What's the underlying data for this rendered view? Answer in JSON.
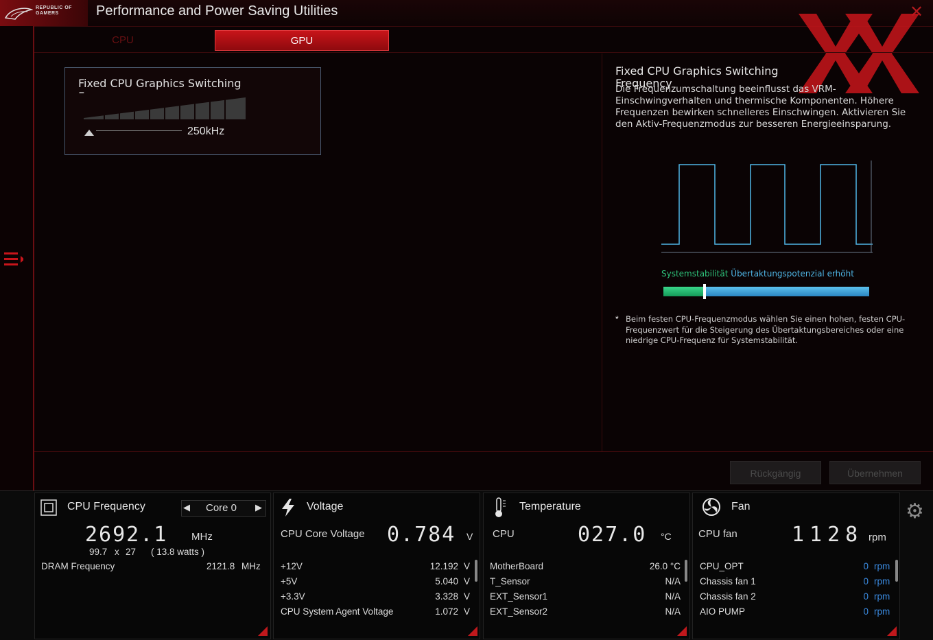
{
  "app": {
    "badge_text": "REPUBLIC OF GAMERS",
    "title": "Performance and Power Saving Utilities",
    "close_glyph": "✕"
  },
  "tabs": [
    {
      "label": "CPU",
      "active": false
    },
    {
      "label": "GPU",
      "active": true
    }
  ],
  "setting_card": {
    "title": "Fixed CPU Graphics Switching Frequency",
    "value": "250kHz"
  },
  "info_panel": {
    "title": "Fixed CPU Graphics Switching Frequency",
    "description": "Die Frequenzumschaltung beeinflusst das VRM-Einschwingverhalten und thermische Komponenten. Höhere Frequenzen bewirken schnelleres Einschwingen. Aktivieren Sie den Aktiv-Frequenzmodus zur besseren Energieeinsparung.",
    "stability_label": "Systemstabilität",
    "overclock_label": "Übertaktungspotenzial erhöht",
    "stability_level": 0.2,
    "note_star": "*",
    "note": "Beim festen CPU-Frequenzmodus wählen Sie einen hohen, festen CPU-Frequenzwert für die Steigerung des Übertaktungsbereiches oder eine niedrige CPU-Frequenz für Systemstabilität."
  },
  "actions": {
    "undo_label": "Rückgängig",
    "apply_label": "Übernehmen"
  },
  "monitor": {
    "cpu": {
      "title": "CPU Frequency",
      "core_selector": "Core 0",
      "value": "2692.1",
      "unit": "MHz",
      "multiplier_base": "99.7",
      "multiplier_x": "x",
      "multiplier_ratio": "27",
      "power": "( 13.8 watts )",
      "dram_label": "DRAM Frequency",
      "dram_value": "2121.8",
      "dram_unit": "MHz"
    },
    "voltage": {
      "title": "Voltage",
      "main_label": "CPU Core Voltage",
      "main_value": "0.784",
      "main_unit": "V",
      "rows": [
        {
          "label": "+12V",
          "value": "12.192",
          "unit": "V"
        },
        {
          "label": "+5V",
          "value": "5.040",
          "unit": "V"
        },
        {
          "label": "+3.3V",
          "value": "3.328",
          "unit": "V"
        },
        {
          "label": "CPU System Agent Voltage",
          "value": "1.072",
          "unit": "V"
        }
      ]
    },
    "temperature": {
      "title": "Temperature",
      "main_label": "CPU",
      "main_value": "027.0",
      "main_unit": "°C",
      "rows": [
        {
          "label": "MotherBoard",
          "value": "26.0 °C"
        },
        {
          "label": "T_Sensor",
          "value": "N/A"
        },
        {
          "label": "EXT_Sensor1",
          "value": "N/A"
        },
        {
          "label": "EXT_Sensor2",
          "value": "N/A"
        }
      ]
    },
    "fan": {
      "title": "Fan",
      "main_label": "CPU fan",
      "main_value": "1128",
      "main_unit": "rpm",
      "rows": [
        {
          "label": "CPU_OPT",
          "value": "0",
          "unit": "rpm"
        },
        {
          "label": "Chassis fan 1",
          "value": "0",
          "unit": "rpm"
        },
        {
          "label": "Chassis fan 2",
          "value": "0",
          "unit": "rpm"
        },
        {
          "label": "AIO PUMP",
          "value": "0",
          "unit": "rpm"
        }
      ]
    }
  },
  "icons": {
    "menu": "menu-expand-icon",
    "cpu": "cpu-chip-icon",
    "voltage": "lightning-icon",
    "temperature": "thermometer-icon",
    "fan": "fan-icon",
    "settings": "gear-icon",
    "chevron_left": "◀",
    "chevron_right": "▶",
    "settings_glyph": "⚙"
  },
  "colors": {
    "accent_red": "#c81419",
    "wave_blue": "#4fb6e6",
    "stability_green": "#2ec27a",
    "fan_rpm_blue": "#3a8ae0"
  }
}
